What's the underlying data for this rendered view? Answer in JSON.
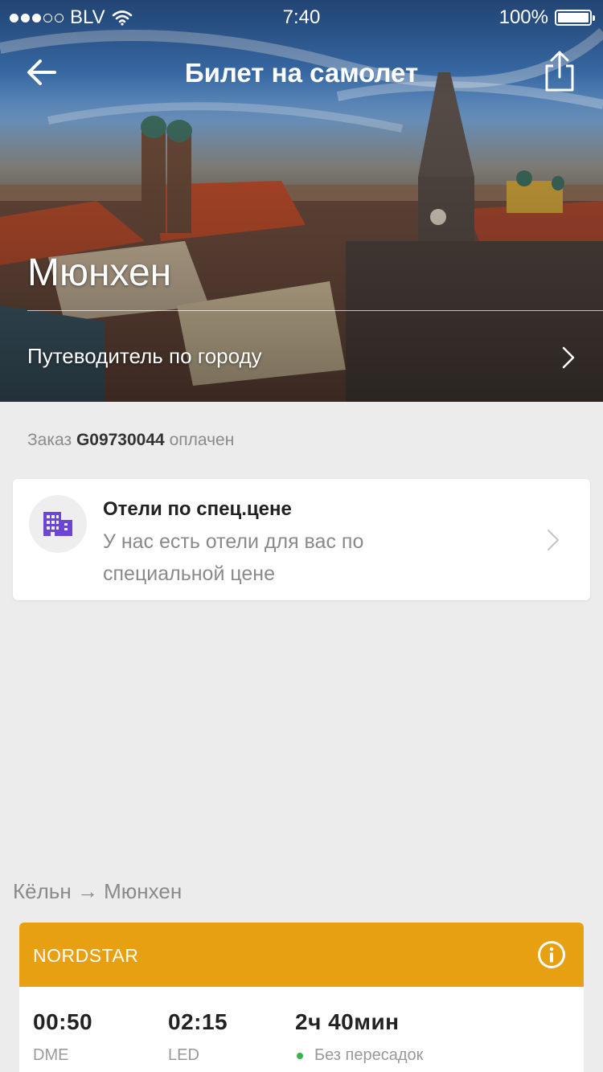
{
  "status_bar": {
    "carrier": "BLV",
    "time": "7:40",
    "battery": "100%",
    "signal_bars_filled": 3,
    "signal_bars_total": 5
  },
  "nav": {
    "title": "Билет на самолет",
    "back_icon": "arrow-left-icon",
    "share_icon": "share-icon"
  },
  "hero": {
    "city": "Мюнхен",
    "guide_label": "Путеводитель по городу"
  },
  "order": {
    "prefix": "Заказ",
    "number": "G09730044",
    "status": "оплачен"
  },
  "hotel_offer": {
    "title": "Отели по спец.цене",
    "subtitle": "У нас есть отели для вас по специальной цене",
    "icon": "hotel-building-icon",
    "icon_color": "#6a45d6"
  },
  "route": {
    "label": "Кёльн → Мюнхен"
  },
  "ticket": {
    "airline": "NORDSTAR",
    "header_color": "#e6a011",
    "departure_time": "00:50",
    "departure_airport": "DME",
    "arrival_time": "02:15",
    "arrival_airport": "LED",
    "duration": "2ч 40мин",
    "stops": "Без пересадок",
    "stops_color": "#35b54a"
  }
}
